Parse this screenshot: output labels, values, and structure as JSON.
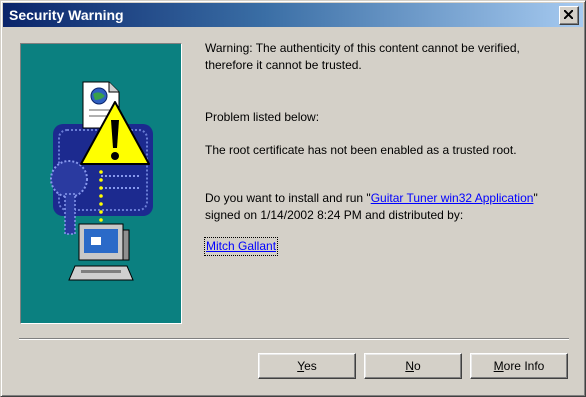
{
  "window": {
    "title": "Security Warning",
    "close_label": "×"
  },
  "message": {
    "warning_line1": "Warning: The authenticity of this content cannot be verified,",
    "warning_line2": "therefore it cannot be trusted.",
    "problem_heading": "Problem listed below:",
    "problem_text": "The root certificate has not been enabled as a trusted root.",
    "question_prefix": "Do you want to install and run \"",
    "application_link": "Guitar Tuner win32 Application",
    "question_suffix": "\"",
    "signed_line": "signed on 1/14/2002 8:24 PM and distributed by:",
    "publisher_link": "Mitch Gallant"
  },
  "buttons": {
    "yes": {
      "mnemonic": "Y",
      "rest": "es"
    },
    "no": {
      "mnemonic": "N",
      "rest": "o"
    },
    "more_info": {
      "mnemonic": "M",
      "rest": "ore Info"
    }
  },
  "colors": {
    "accent_teal": "#0b8080",
    "warning_yellow": "#ffff00",
    "title_gradient_start": "#0a246a",
    "link_blue": "#0000ff"
  },
  "icons": [
    "close-icon",
    "document-globe-icon",
    "warning-triangle-icon",
    "certificate-key-icon",
    "computer-icon"
  ]
}
